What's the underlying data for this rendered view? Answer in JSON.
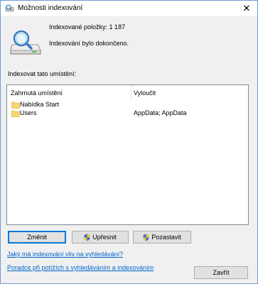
{
  "window": {
    "title": "Možnosti indexování"
  },
  "status": {
    "indexed_items": "Indexované položky: 1 187",
    "message": "Indexování bylo dokončeno."
  },
  "locations": {
    "label": "Indexovat tato umístění:",
    "col_included": "Zahrnutá umístění",
    "col_excluded": "Vyloučit",
    "rows": [
      {
        "name": "Nabídka Start",
        "exclude": ""
      },
      {
        "name": "Users",
        "exclude": "AppData; AppData"
      }
    ]
  },
  "buttons": {
    "modify": "Změnit",
    "advanced": "Upřesnit",
    "pause": "Pozastavit",
    "close": "Zavřít"
  },
  "links": {
    "how_affects": "Jaký má indexování vliv na vyhledávání?",
    "troubleshoot": "Poradce při potížích s vyhledáváním a indexováním"
  },
  "icons": {
    "app": "indexing-options-icon",
    "close": "close-icon",
    "big": "drive-magnifier-icon",
    "folder": "folder-icon",
    "shield": "uac-shield-icon"
  },
  "colors": {
    "link": "#0066cc",
    "accent": "#0078d7",
    "folder": "#f6d673"
  }
}
